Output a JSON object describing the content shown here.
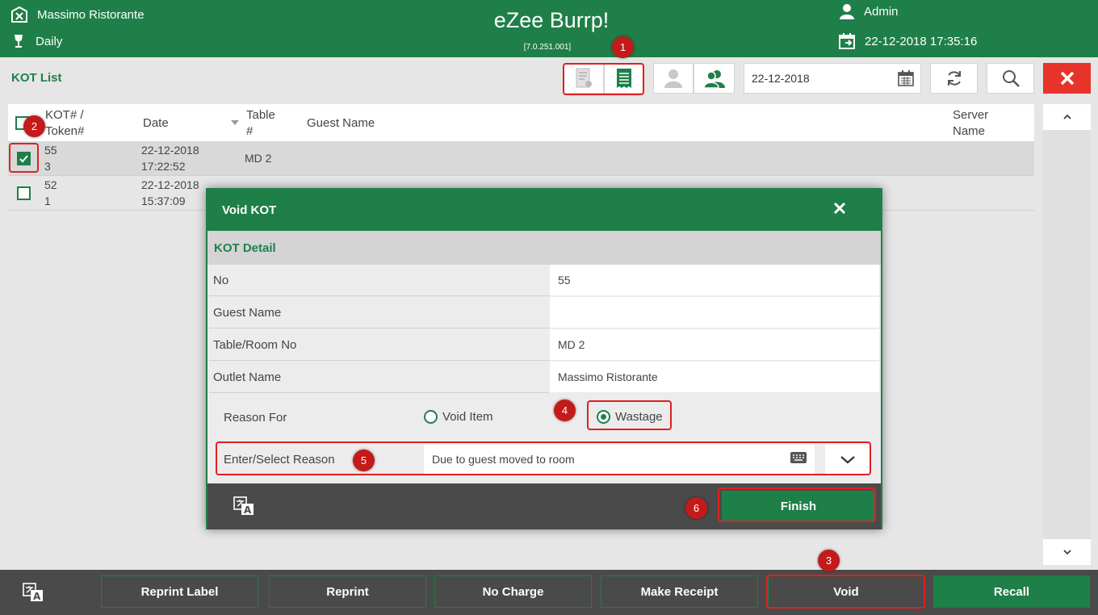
{
  "header": {
    "outlet": "Massimo Ristorante",
    "meal_period": "Daily",
    "app_title": "eZee Burrp!",
    "version": "[7.0.251.001]",
    "user": "Admin",
    "datetime": "22-12-2018 17:35:16"
  },
  "toolbar": {
    "page_title": "KOT List",
    "date_value": "22-12-2018"
  },
  "list": {
    "columns": {
      "kot_line1": "KOT# /",
      "kot_line2": "Token#",
      "date": "Date",
      "table_line1": "Table",
      "table_line2": "#",
      "guest": "Guest Name",
      "server_line1": "Server",
      "server_line2": "Name"
    },
    "rows": [
      {
        "kot": "55",
        "token": "3",
        "date": "22-12-2018",
        "time": "17:22:52",
        "table": "MD 2",
        "checked": true
      },
      {
        "kot": "52",
        "token": "1",
        "date": "22-12-2018",
        "time": "15:37:09",
        "table": "",
        "checked": false
      }
    ]
  },
  "modal": {
    "title": "Void KOT",
    "section": "KOT Detail",
    "details": [
      {
        "label": "No",
        "value": "55"
      },
      {
        "label": "Guest Name",
        "value": ""
      },
      {
        "label": "Table/Room No",
        "value": "MD 2"
      },
      {
        "label": "Outlet Name",
        "value": "Massimo Ristorante"
      }
    ],
    "reason_for_label": "Reason For",
    "option_void_item": "Void Item",
    "option_wastage": "Wastage",
    "selected_option": "Wastage",
    "reason_label": "Enter/Select Reason",
    "reason_value": "Due to guest moved to room",
    "finish_label": "Finish"
  },
  "bottom_bar": {
    "reprint_label": "Reprint Label",
    "reprint": "Reprint",
    "no_charge": "No Charge",
    "make_receipt": "Make Receipt",
    "void": "Void",
    "recall": "Recall"
  },
  "callouts": [
    "1",
    "2",
    "3",
    "4",
    "5",
    "6"
  ],
  "colors": {
    "brand_green": "#1f7f48",
    "dark_bar": "#4a4a4a",
    "close_red": "#e8332b",
    "callout_red": "#c41a1a"
  },
  "icons": [
    "outlet-icon",
    "wine-glass-icon",
    "user-icon",
    "calendar-icon",
    "void-kot-icon",
    "kot-list-icon",
    "single-guest-icon",
    "group-guest-icon",
    "refresh-icon",
    "search-icon",
    "close-icon",
    "keyboard-icon",
    "chevron-down-icon",
    "language-icon"
  ]
}
